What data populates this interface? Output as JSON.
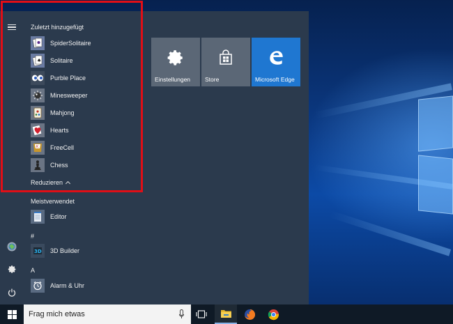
{
  "start_menu": {
    "recent_section": {
      "heading": "Zuletzt hinzugefügt",
      "items": [
        {
          "label": "SpiderSolitaire",
          "icon": "spider-solitaire-icon"
        },
        {
          "label": "Solitaire",
          "icon": "solitaire-icon"
        },
        {
          "label": "Purble Place",
          "icon": "purble-place-icon"
        },
        {
          "label": "Minesweeper",
          "icon": "minesweeper-icon"
        },
        {
          "label": "Mahjong",
          "icon": "mahjong-icon"
        },
        {
          "label": "Hearts",
          "icon": "hearts-icon"
        },
        {
          "label": "FreeCell",
          "icon": "freecell-icon"
        },
        {
          "label": "Chess",
          "icon": "chess-icon"
        }
      ],
      "collapse_label": "Reduzieren"
    },
    "most_used": {
      "heading": "Meistverwendet",
      "items": [
        {
          "label": "Editor",
          "icon": "notepad-icon"
        }
      ]
    },
    "letter_groups": [
      {
        "letter": "#",
        "items": [
          {
            "label": "3D Builder",
            "icon": "3d-builder-icon"
          }
        ]
      },
      {
        "letter": "A",
        "items": [
          {
            "label": "Alarm & Uhr",
            "icon": "alarm-clock-icon"
          }
        ]
      }
    ],
    "tiles": [
      {
        "label": "Einstellungen",
        "icon": "gear-icon",
        "color": "#5b6776"
      },
      {
        "label": "Store",
        "icon": "store-bag-icon",
        "color": "#5b6776"
      },
      {
        "label": "Microsoft Edge",
        "icon": "edge-icon",
        "color": "#1f77d1"
      }
    ]
  },
  "taskbar": {
    "search_placeholder": "Frag mich etwas",
    "pinned": [
      "task-view-icon",
      "file-explorer-icon",
      "firefox-icon",
      "chrome-icon"
    ]
  },
  "colors": {
    "highlight_frame": "#e10e16",
    "menu_bg": "#2b3a4d",
    "taskbar_bg": "#0f1a26",
    "edge_tile": "#1f77d1"
  }
}
